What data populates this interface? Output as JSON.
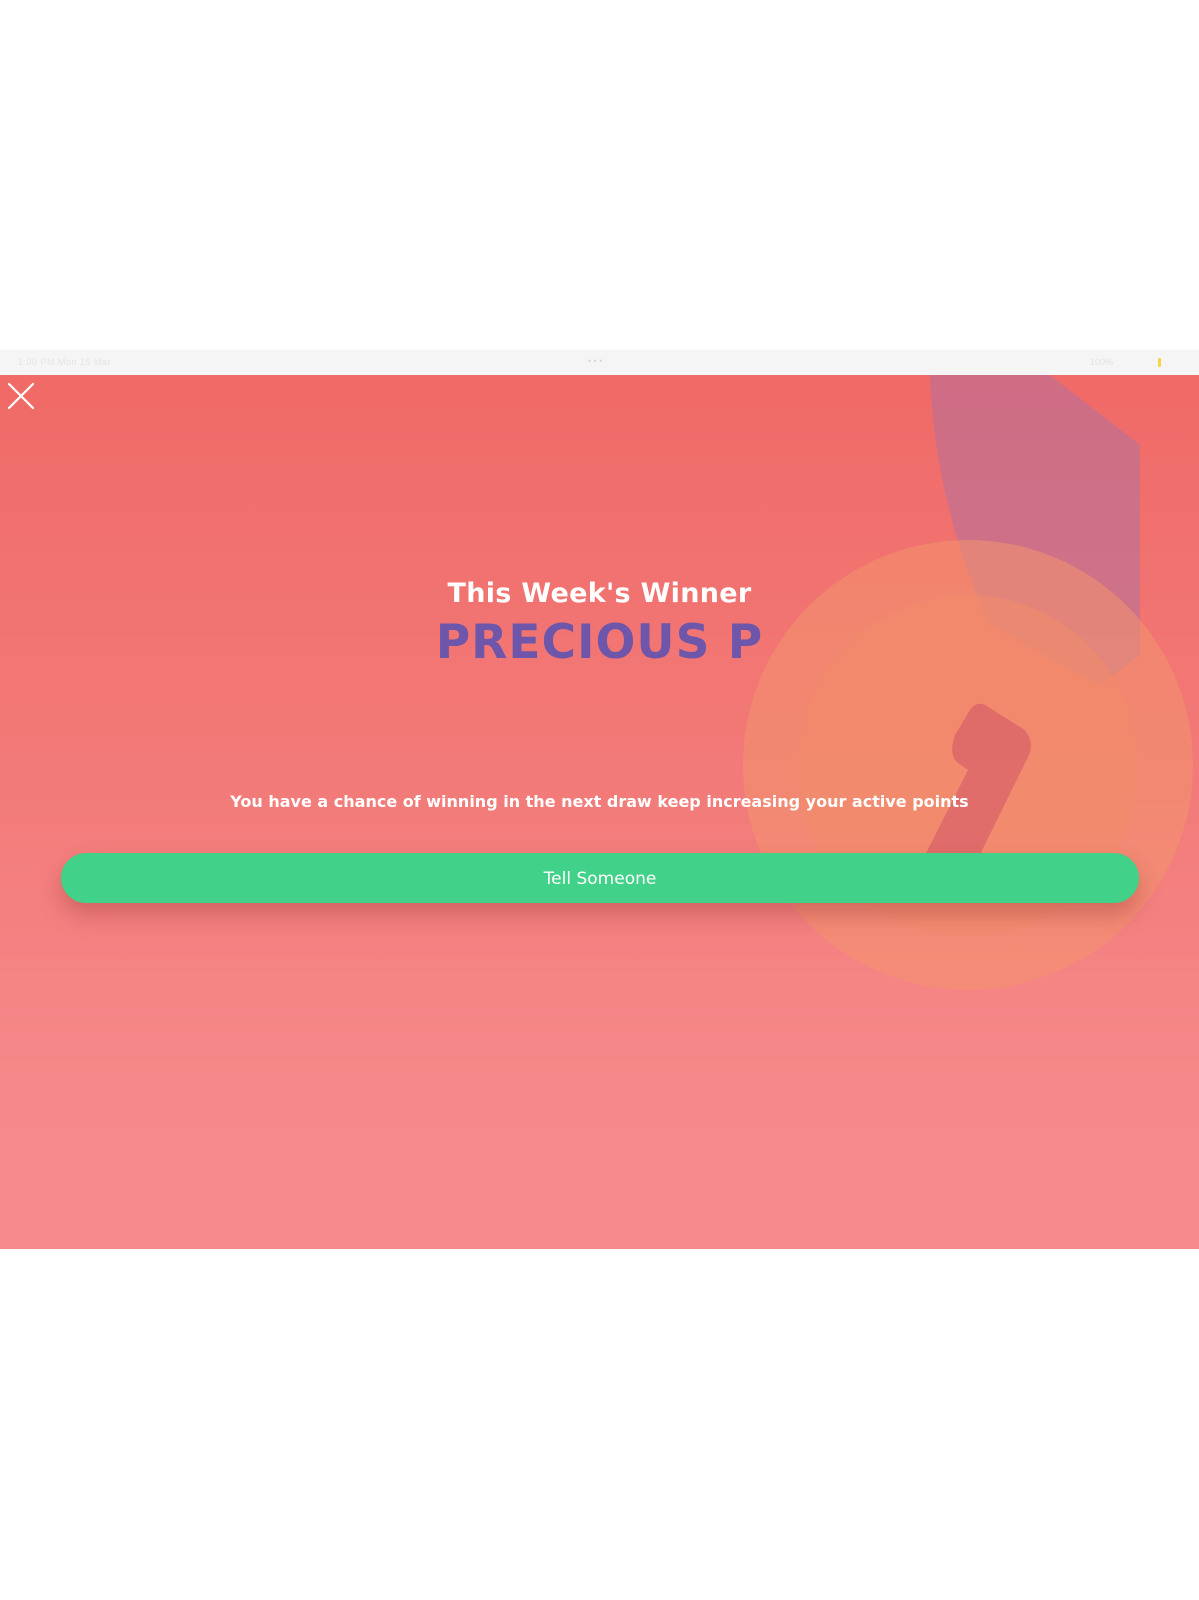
{
  "status_bar": {
    "left_text": "1:00 PM  Mon 15 Mar",
    "center_text": "• • •",
    "right_text": "100%"
  },
  "modal": {
    "close_icon": "close-icon",
    "title": "This Week's Winner",
    "winner_name": "PRECIOUS P",
    "message": "You have a chance of winning in the next draw keep increasing your active points",
    "tell_button_label": "Tell Someone"
  },
  "colors": {
    "panel_top": "#f06a67",
    "panel_bottom": "#f78a8c",
    "winner_name": "#6e56aa",
    "button": "#41d189",
    "text": "#ffffff"
  }
}
